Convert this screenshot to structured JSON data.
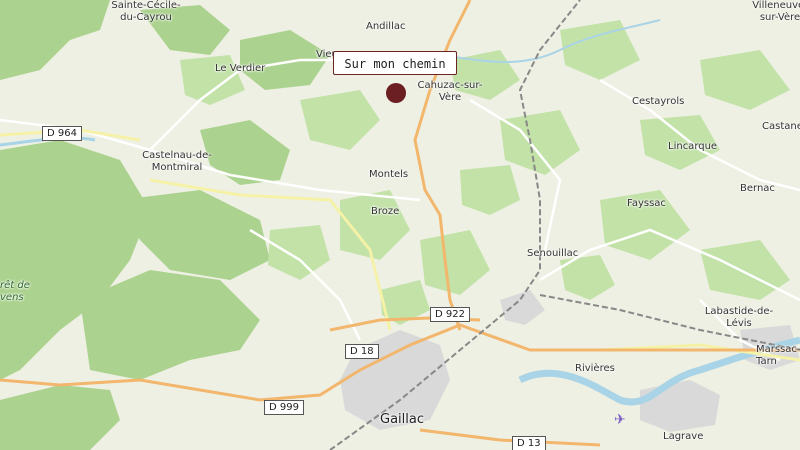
{
  "map": {
    "tooltip": "Sur mon chemin",
    "marker_color": "#6b1f22",
    "places": [
      {
        "id": "sainte-cecile",
        "label": "Sainte-Cécile-\ndu-Cayrou"
      },
      {
        "id": "andillac",
        "label": "Andillac"
      },
      {
        "id": "vieux",
        "label": "Vieu"
      },
      {
        "id": "villeneuve",
        "label": "Villeneuve-\nsur-Vère"
      },
      {
        "id": "le-verdier",
        "label": "Le Verdier"
      },
      {
        "id": "cahuzac",
        "label": "Cahuzac-sur-\nVère"
      },
      {
        "id": "cestayrols",
        "label": "Cestayrols"
      },
      {
        "id": "castanet",
        "label": "Castane"
      },
      {
        "id": "castelnau",
        "label": "Castelnau-de-\nMontmiral"
      },
      {
        "id": "lincarque",
        "label": "Lincarque"
      },
      {
        "id": "montels",
        "label": "Montels"
      },
      {
        "id": "bernac",
        "label": "Bernac"
      },
      {
        "id": "broze",
        "label": "Broze"
      },
      {
        "id": "fayssac",
        "label": "Fayssac"
      },
      {
        "id": "senouillac",
        "label": "Senouillac"
      },
      {
        "id": "labastide",
        "label": "Labastide-de-\nLévis"
      },
      {
        "id": "marssac",
        "label": "Marssac-s\nTarn"
      },
      {
        "id": "rivieres",
        "label": "Rivières"
      },
      {
        "id": "gaillac",
        "label": "Gaillac"
      },
      {
        "id": "lagrave",
        "label": "Lagrave"
      },
      {
        "id": "foret",
        "label": "rêt de\nvens"
      }
    ],
    "roads": [
      {
        "id": "d964",
        "label": "D 964"
      },
      {
        "id": "d922",
        "label": "D 922"
      },
      {
        "id": "d18",
        "label": "D 18"
      },
      {
        "id": "d999",
        "label": "D 999"
      },
      {
        "id": "d13",
        "label": "D 13"
      }
    ]
  }
}
